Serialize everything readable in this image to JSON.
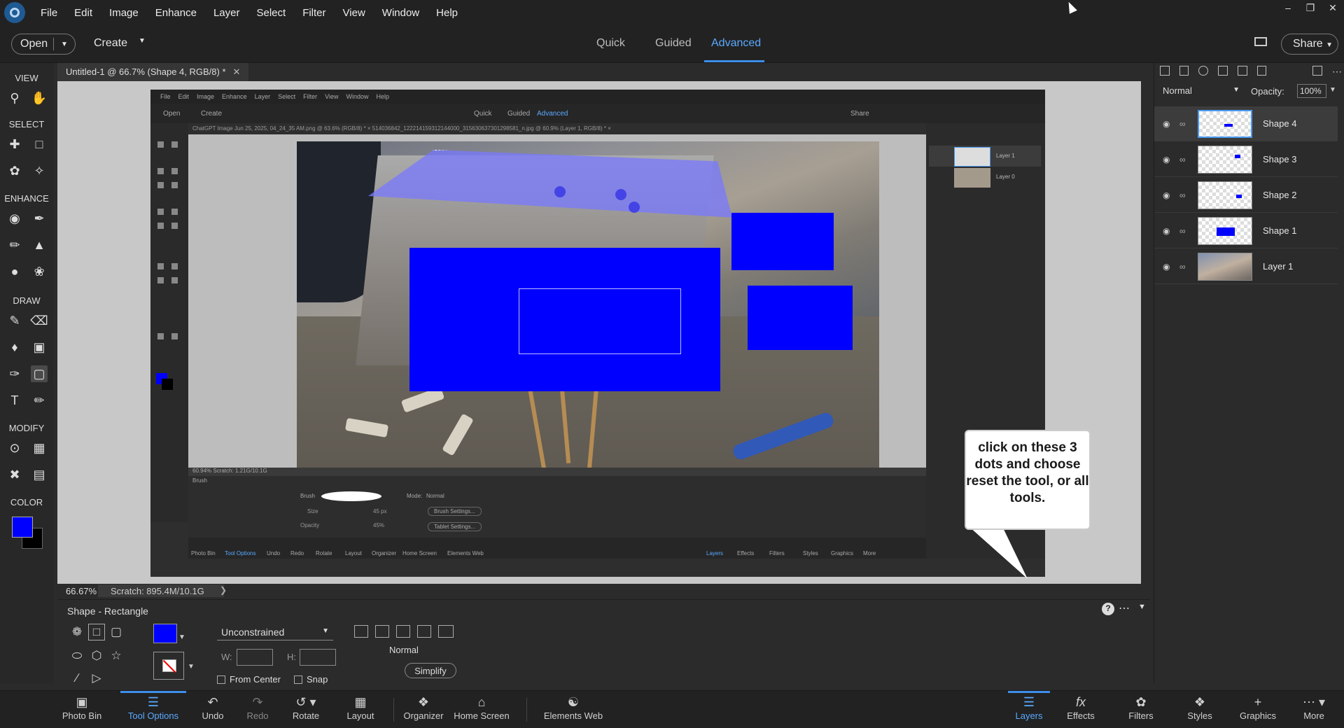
{
  "menubar": {
    "items": [
      "File",
      "Edit",
      "Image",
      "Enhance",
      "Layer",
      "Select",
      "Filter",
      "View",
      "Window",
      "Help"
    ]
  },
  "topbar": {
    "open_label": "Open",
    "create_label": "Create",
    "mode_tabs": [
      "Quick",
      "Guided",
      "Advanced"
    ],
    "active_mode": "Advanced",
    "share_label": "Share"
  },
  "toolbox": {
    "sections": [
      "VIEW",
      "SELECT",
      "ENHANCE",
      "DRAW",
      "MODIFY",
      "COLOR"
    ],
    "foreground_color": "#0000ff",
    "background_color": "#000000"
  },
  "document": {
    "tab_title": "Untitled-1 @ 66.7% (Shape 4, RGB/8) *",
    "zoom": "66.67%",
    "scratch": "Scratch: 895.4M/10.1G"
  },
  "inner_screenshot": {
    "menu": [
      "File",
      "Edit",
      "Image",
      "Enhance",
      "Layer",
      "Select",
      "Filter",
      "View",
      "Window",
      "Help"
    ],
    "open_label": "Open",
    "create_label": "Create",
    "modes": [
      "Quick",
      "Guided",
      "Advanced"
    ],
    "share_label": "Share",
    "tabs_text": "ChatGPT Image Jun 25, 2025, 04_24_35 AM.png @ 63.6% (RGB/8) *  ×    514036842_122214159312144000_315630637301298581_n.jpg @ 60.9% (Layer 1, RGB/8) *  ×",
    "status": "60.94%   Scratch: 1.21G/10.1G",
    "brush_label": "Brush",
    "mode_label": "Mode:",
    "mode_value": "Normal",
    "size_label": "Size",
    "size_value": "45 px",
    "opacity_label": "Opacity",
    "opacity_value": "45%",
    "brush_settings": "Brush Settings...",
    "tablet_settings": "Tablet Settings...",
    "layers": [
      "Layer 1",
      "Layer 0"
    ],
    "bottom": [
      "Photo Bin",
      "Tool Options",
      "Undo",
      "Redo",
      "Rotate",
      "Layout",
      "Organizer",
      "Home Screen",
      "Elements Web",
      "Layers",
      "Effects",
      "Filters",
      "Styles",
      "Graphics",
      "More"
    ]
  },
  "callout": {
    "text": "click on these 3 dots and choose reset the tool, or all tools."
  },
  "tool_options": {
    "title": "Shape - Rectangle",
    "fill_color": "#0000ff",
    "constrain_value": "Unconstrained",
    "w_label": "W:",
    "h_label": "H:",
    "from_center_label": "From Center",
    "snap_label": "Snap",
    "blend_label": "Normal",
    "simplify_label": "Simplify"
  },
  "layer_panel": {
    "blend_mode": "Normal",
    "opacity_label": "Opacity:",
    "opacity_value": "100%",
    "layers": [
      {
        "name": "Shape 4",
        "selected": true
      },
      {
        "name": "Shape 3",
        "selected": false
      },
      {
        "name": "Shape 2",
        "selected": false
      },
      {
        "name": "Shape 1",
        "selected": false
      },
      {
        "name": "Layer 1",
        "selected": false
      }
    ]
  },
  "taskbar": {
    "left": [
      "Photo Bin",
      "Tool Options",
      "Undo",
      "Redo",
      "Rotate",
      "Layout",
      "Organizer",
      "Home Screen",
      "Elements Web"
    ],
    "right": [
      "Layers",
      "Effects",
      "Filters",
      "Styles",
      "Graphics",
      "More"
    ],
    "active_left": "Tool Options",
    "active_right": "Layers"
  },
  "colors": {
    "accent": "#3d8eea",
    "shape_blue": "#0000ff"
  }
}
